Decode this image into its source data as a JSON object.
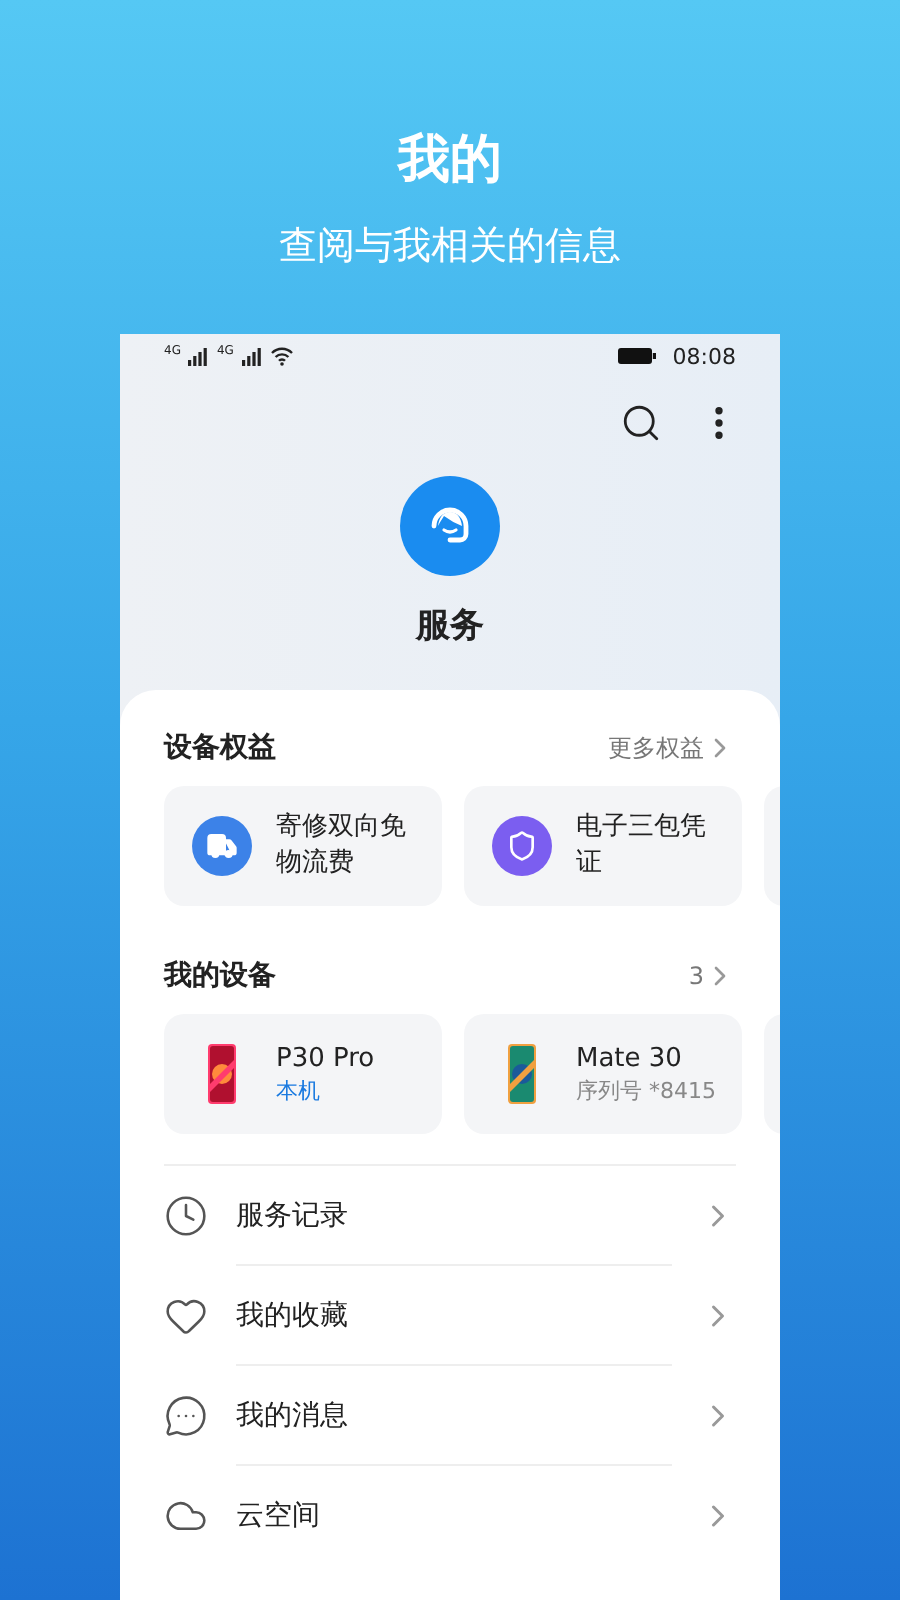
{
  "header": {
    "title": "我的",
    "subtitle": "查阅与我相关的信息"
  },
  "status_bar": {
    "network_1": "4G",
    "network_2": "4G",
    "time": "08:08"
  },
  "page": {
    "title": "服务"
  },
  "benefits": {
    "title": "设备权益",
    "more": "更多权益",
    "items": [
      {
        "kind": "delivery",
        "label": "寄修双向免物流费"
      },
      {
        "kind": "warranty",
        "label": "电子三包凭证"
      }
    ]
  },
  "devices": {
    "title": "我的设备",
    "count": "3",
    "items": [
      {
        "name": "P30 Pro",
        "note": "本机",
        "current": true
      },
      {
        "name": "Mate 30",
        "note": "序列号 *8415",
        "current": false
      }
    ]
  },
  "menu": [
    {
      "kind": "history",
      "label": "服务记录"
    },
    {
      "kind": "favorites",
      "label": "我的收藏"
    },
    {
      "kind": "messages",
      "label": "我的消息"
    },
    {
      "kind": "cloud",
      "label": "云空间"
    }
  ]
}
